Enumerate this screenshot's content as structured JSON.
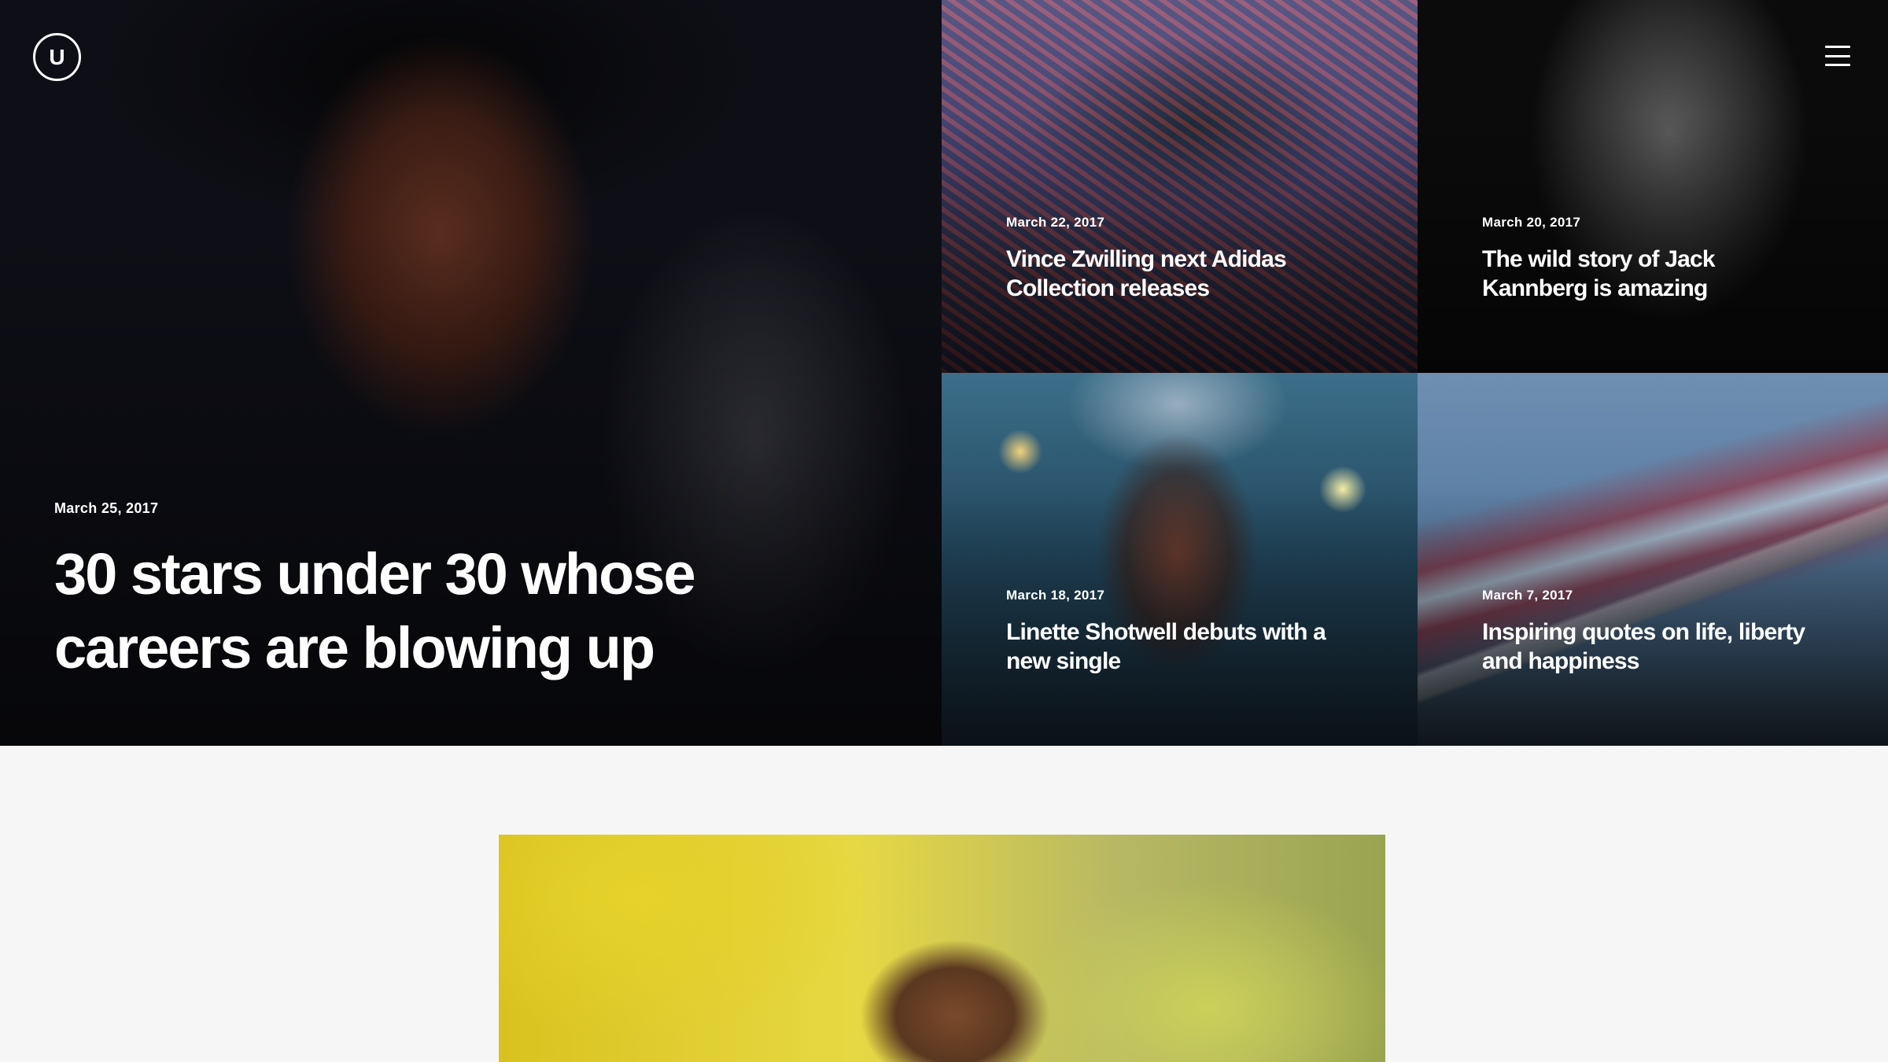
{
  "header": {
    "logo_letter": "U",
    "logo_icon": "u-circle-logo-icon",
    "menu_icon": "hamburger-menu-icon"
  },
  "featured": {
    "date": "March 25, 2017",
    "title": "30 stars under 30 whose careers are blowing up"
  },
  "articles": [
    {
      "date": "March 22, 2017",
      "title": "Vince Zwilling next Adidas Collection releases"
    },
    {
      "date": "March 20, 2017",
      "title": "The wild story of Jack Kannberg is amazing"
    },
    {
      "date": "March 18, 2017",
      "title": "Linette Shotwell debuts with a new single"
    },
    {
      "date": "March 7, 2017",
      "title": "Inspiring quotes on life, liberty and happiness"
    }
  ],
  "colors": {
    "text": "#ffffff",
    "page_background": "#f6f6f6",
    "hero_background": "#0c0e14"
  }
}
